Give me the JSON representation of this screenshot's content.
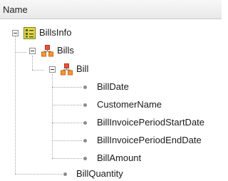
{
  "header": {
    "column_name": "Name"
  },
  "tree": {
    "root": {
      "label": "BillsInfo",
      "icon": "structure-root-icon"
    },
    "level1": {
      "label": "Bills",
      "icon": "collection-icon"
    },
    "level2": {
      "label": "Bill",
      "icon": "collection-icon"
    },
    "bill_attributes": [
      "BillDate",
      "CustomerName",
      "BillInvoicePeriodStartDate",
      "BillInvoicePeriodEndDate",
      "BillAmount"
    ],
    "root_attributes": [
      "BillQuantity"
    ]
  },
  "colors": {
    "root_icon_border": "#6a8a1a",
    "root_icon_fill": "#f2d04a",
    "collection_top": "#e6533a",
    "collection_bottom": "#f29a2e"
  }
}
